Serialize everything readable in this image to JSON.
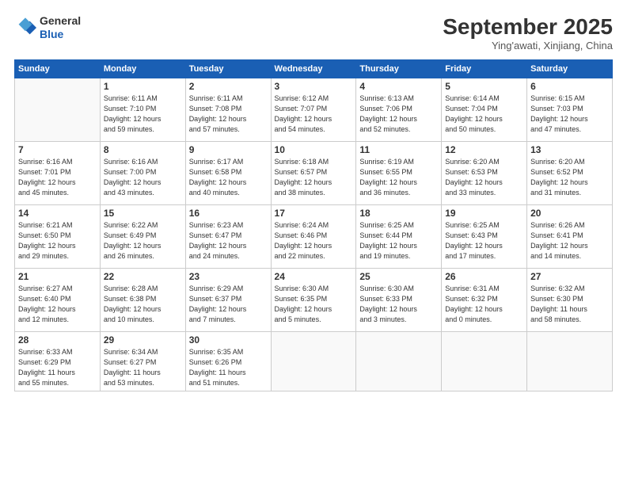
{
  "header": {
    "logo": {
      "line1": "General",
      "line2": "Blue"
    },
    "title": "September 2025",
    "location": "Ying'awati, Xinjiang, China"
  },
  "weekdays": [
    "Sunday",
    "Monday",
    "Tuesday",
    "Wednesday",
    "Thursday",
    "Friday",
    "Saturday"
  ],
  "weeks": [
    [
      {
        "day": "",
        "info": ""
      },
      {
        "day": "1",
        "info": "Sunrise: 6:11 AM\nSunset: 7:10 PM\nDaylight: 12 hours\nand 59 minutes."
      },
      {
        "day": "2",
        "info": "Sunrise: 6:11 AM\nSunset: 7:08 PM\nDaylight: 12 hours\nand 57 minutes."
      },
      {
        "day": "3",
        "info": "Sunrise: 6:12 AM\nSunset: 7:07 PM\nDaylight: 12 hours\nand 54 minutes."
      },
      {
        "day": "4",
        "info": "Sunrise: 6:13 AM\nSunset: 7:06 PM\nDaylight: 12 hours\nand 52 minutes."
      },
      {
        "day": "5",
        "info": "Sunrise: 6:14 AM\nSunset: 7:04 PM\nDaylight: 12 hours\nand 50 minutes."
      },
      {
        "day": "6",
        "info": "Sunrise: 6:15 AM\nSunset: 7:03 PM\nDaylight: 12 hours\nand 47 minutes."
      }
    ],
    [
      {
        "day": "7",
        "info": "Sunrise: 6:16 AM\nSunset: 7:01 PM\nDaylight: 12 hours\nand 45 minutes."
      },
      {
        "day": "8",
        "info": "Sunrise: 6:16 AM\nSunset: 7:00 PM\nDaylight: 12 hours\nand 43 minutes."
      },
      {
        "day": "9",
        "info": "Sunrise: 6:17 AM\nSunset: 6:58 PM\nDaylight: 12 hours\nand 40 minutes."
      },
      {
        "day": "10",
        "info": "Sunrise: 6:18 AM\nSunset: 6:57 PM\nDaylight: 12 hours\nand 38 minutes."
      },
      {
        "day": "11",
        "info": "Sunrise: 6:19 AM\nSunset: 6:55 PM\nDaylight: 12 hours\nand 36 minutes."
      },
      {
        "day": "12",
        "info": "Sunrise: 6:20 AM\nSunset: 6:53 PM\nDaylight: 12 hours\nand 33 minutes."
      },
      {
        "day": "13",
        "info": "Sunrise: 6:20 AM\nSunset: 6:52 PM\nDaylight: 12 hours\nand 31 minutes."
      }
    ],
    [
      {
        "day": "14",
        "info": "Sunrise: 6:21 AM\nSunset: 6:50 PM\nDaylight: 12 hours\nand 29 minutes."
      },
      {
        "day": "15",
        "info": "Sunrise: 6:22 AM\nSunset: 6:49 PM\nDaylight: 12 hours\nand 26 minutes."
      },
      {
        "day": "16",
        "info": "Sunrise: 6:23 AM\nSunset: 6:47 PM\nDaylight: 12 hours\nand 24 minutes."
      },
      {
        "day": "17",
        "info": "Sunrise: 6:24 AM\nSunset: 6:46 PM\nDaylight: 12 hours\nand 22 minutes."
      },
      {
        "day": "18",
        "info": "Sunrise: 6:25 AM\nSunset: 6:44 PM\nDaylight: 12 hours\nand 19 minutes."
      },
      {
        "day": "19",
        "info": "Sunrise: 6:25 AM\nSunset: 6:43 PM\nDaylight: 12 hours\nand 17 minutes."
      },
      {
        "day": "20",
        "info": "Sunrise: 6:26 AM\nSunset: 6:41 PM\nDaylight: 12 hours\nand 14 minutes."
      }
    ],
    [
      {
        "day": "21",
        "info": "Sunrise: 6:27 AM\nSunset: 6:40 PM\nDaylight: 12 hours\nand 12 minutes."
      },
      {
        "day": "22",
        "info": "Sunrise: 6:28 AM\nSunset: 6:38 PM\nDaylight: 12 hours\nand 10 minutes."
      },
      {
        "day": "23",
        "info": "Sunrise: 6:29 AM\nSunset: 6:37 PM\nDaylight: 12 hours\nand 7 minutes."
      },
      {
        "day": "24",
        "info": "Sunrise: 6:30 AM\nSunset: 6:35 PM\nDaylight: 12 hours\nand 5 minutes."
      },
      {
        "day": "25",
        "info": "Sunrise: 6:30 AM\nSunset: 6:33 PM\nDaylight: 12 hours\nand 3 minutes."
      },
      {
        "day": "26",
        "info": "Sunrise: 6:31 AM\nSunset: 6:32 PM\nDaylight: 12 hours\nand 0 minutes."
      },
      {
        "day": "27",
        "info": "Sunrise: 6:32 AM\nSunset: 6:30 PM\nDaylight: 11 hours\nand 58 minutes."
      }
    ],
    [
      {
        "day": "28",
        "info": "Sunrise: 6:33 AM\nSunset: 6:29 PM\nDaylight: 11 hours\nand 55 minutes."
      },
      {
        "day": "29",
        "info": "Sunrise: 6:34 AM\nSunset: 6:27 PM\nDaylight: 11 hours\nand 53 minutes."
      },
      {
        "day": "30",
        "info": "Sunrise: 6:35 AM\nSunset: 6:26 PM\nDaylight: 11 hours\nand 51 minutes."
      },
      {
        "day": "",
        "info": ""
      },
      {
        "day": "",
        "info": ""
      },
      {
        "day": "",
        "info": ""
      },
      {
        "day": "",
        "info": ""
      }
    ]
  ]
}
